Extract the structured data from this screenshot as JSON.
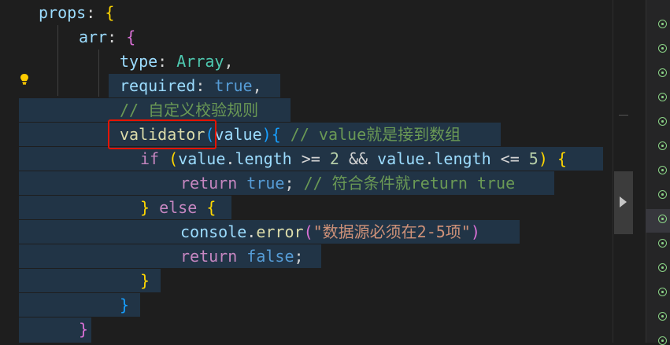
{
  "editor": {
    "lines": [
      {
        "id": "l1",
        "tokens": [
          [
            "prop",
            "props"
          ],
          [
            "pun",
            ": "
          ],
          [
            "br",
            "{"
          ]
        ]
      },
      {
        "id": "l2",
        "tokens": [
          [
            "prop",
            "arr"
          ],
          [
            "pun",
            ": "
          ],
          [
            "br2",
            "{"
          ]
        ]
      },
      {
        "id": "l3",
        "tokens": [
          [
            "prop",
            "type"
          ],
          [
            "pun",
            ": "
          ],
          [
            "ty",
            "Array"
          ],
          [
            "pun",
            ","
          ]
        ]
      },
      {
        "id": "l4",
        "tokens": [
          [
            "prop",
            "required"
          ],
          [
            "pun",
            ": "
          ],
          [
            "k",
            "true"
          ],
          [
            "pun",
            ","
          ]
        ]
      },
      {
        "id": "l5",
        "tokens": [
          [
            "com",
            "// 自定义校验规则"
          ]
        ]
      },
      {
        "id": "l6",
        "tokens": [
          [
            "fn",
            "validator"
          ],
          [
            "br3",
            "("
          ],
          [
            "prop",
            "value"
          ],
          [
            "br3",
            ")"
          ],
          [
            "br3",
            "{"
          ],
          [
            "pun",
            " "
          ],
          [
            "com",
            "// value就是接到数组"
          ]
        ]
      },
      {
        "id": "l7",
        "tokens": [
          [
            "kp",
            "if"
          ],
          [
            "pun",
            " "
          ],
          [
            "br",
            "("
          ],
          [
            "prop",
            "value"
          ],
          [
            "pun",
            "."
          ],
          [
            "prop",
            "length"
          ],
          [
            "pun",
            " >= "
          ],
          [
            "num",
            "2"
          ],
          [
            "pun",
            " && "
          ],
          [
            "prop",
            "value"
          ],
          [
            "pun",
            "."
          ],
          [
            "prop",
            "length"
          ],
          [
            "pun",
            " <= "
          ],
          [
            "num",
            "5"
          ],
          [
            "br",
            ")"
          ],
          [
            "pun",
            " "
          ],
          [
            "br",
            "{"
          ]
        ]
      },
      {
        "id": "l8",
        "tokens": [
          [
            "kp",
            "return"
          ],
          [
            "pun",
            " "
          ],
          [
            "k",
            "true"
          ],
          [
            "pun",
            ";"
          ],
          [
            "pun",
            " "
          ],
          [
            "com",
            "// 符合条件就return true"
          ]
        ]
      },
      {
        "id": "l9",
        "tokens": [
          [
            "br",
            "}"
          ],
          [
            "pun",
            " "
          ],
          [
            "kp",
            "else"
          ],
          [
            "pun",
            " "
          ],
          [
            "br",
            "{"
          ]
        ]
      },
      {
        "id": "l10",
        "tokens": [
          [
            "prop",
            "console"
          ],
          [
            "pun",
            "."
          ],
          [
            "fn",
            "error"
          ],
          [
            "br2",
            "("
          ],
          [
            "str",
            "\"数据源必须在2-5项\""
          ],
          [
            "br2",
            ")"
          ]
        ]
      },
      {
        "id": "l11",
        "tokens": [
          [
            "kp",
            "return"
          ],
          [
            "pun",
            " "
          ],
          [
            "k",
            "false"
          ],
          [
            "pun",
            ";"
          ]
        ]
      },
      {
        "id": "l12",
        "tokens": [
          [
            "br",
            "}"
          ]
        ]
      },
      {
        "id": "l13",
        "tokens": [
          [
            "br3",
            "}"
          ]
        ]
      },
      {
        "id": "l14",
        "tokens": [
          [
            "br2",
            "}"
          ]
        ]
      }
    ],
    "lightbulb_icon": "lightbulb-icon"
  },
  "colors": {
    "background": "#1e1e1e",
    "selection": "#264f78",
    "highlight_box": "#e51400",
    "test_icon": "#89d185"
  },
  "right_panel": {
    "icon": "test-circle-icon",
    "rows": 14
  }
}
